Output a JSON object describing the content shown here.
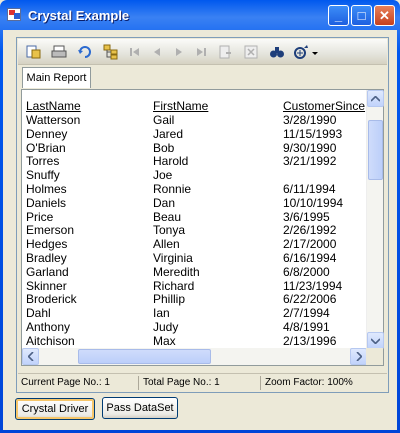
{
  "window": {
    "title": "Crystal Example"
  },
  "title_buttons": {
    "minimize": "_",
    "maximize": "□",
    "close": "✕"
  },
  "toolbar": {
    "icons": [
      "export-icon",
      "print-icon",
      "refresh-icon",
      "group-tree-icon",
      "first-page-icon",
      "previous-page-icon",
      "next-page-icon",
      "last-page-icon",
      "goto-page-icon",
      "close-view-icon",
      "search-icon",
      "zoom-icon"
    ]
  },
  "tabs": [
    {
      "label": "Main Report"
    }
  ],
  "report": {
    "headers": {
      "last_name": "LastName",
      "first_name": "FirstName",
      "customer_since": "CustomerSince"
    },
    "rows": [
      {
        "last": "Watterson",
        "first": "Gail",
        "since": "3/28/1990"
      },
      {
        "last": "Denney",
        "first": "Jared",
        "since": "11/15/1993"
      },
      {
        "last": "O'Brian",
        "first": "Bob",
        "since": "9/30/1990"
      },
      {
        "last": "Torres",
        "first": "Harold",
        "since": "3/21/1992"
      },
      {
        "last": "Snuffy",
        "first": "Joe",
        "since": ""
      },
      {
        "last": "Holmes",
        "first": "Ronnie",
        "since": "6/11/1994"
      },
      {
        "last": "Daniels",
        "first": "Dan",
        "since": "10/10/1994"
      },
      {
        "last": "Price",
        "first": "Beau",
        "since": "3/6/1995"
      },
      {
        "last": "Emerson",
        "first": "Tonya",
        "since": "2/26/1992"
      },
      {
        "last": "Hedges",
        "first": "Allen",
        "since": "2/17/2000"
      },
      {
        "last": "Bradley",
        "first": "Virginia",
        "since": "6/16/1994"
      },
      {
        "last": "Garland",
        "first": "Meredith",
        "since": "6/8/2000"
      },
      {
        "last": "Skinner",
        "first": "Richard",
        "since": "11/23/1994"
      },
      {
        "last": "Broderick",
        "first": "Phillip",
        "since": "6/22/2006"
      },
      {
        "last": "Dahl",
        "first": "Ian",
        "since": "2/7/1994"
      },
      {
        "last": "Anthony",
        "first": "Judy",
        "since": "4/8/1991"
      },
      {
        "last": "Aitchison",
        "first": "Max",
        "since": "2/13/1996"
      }
    ]
  },
  "status": {
    "current_page": "Current Page No.: 1",
    "total_page": "Total Page No.: 1",
    "zoom": "Zoom Factor: 100%"
  },
  "buttons": {
    "crystal_driver": "Crystal Driver",
    "pass_dataset": "Pass DataSet"
  }
}
